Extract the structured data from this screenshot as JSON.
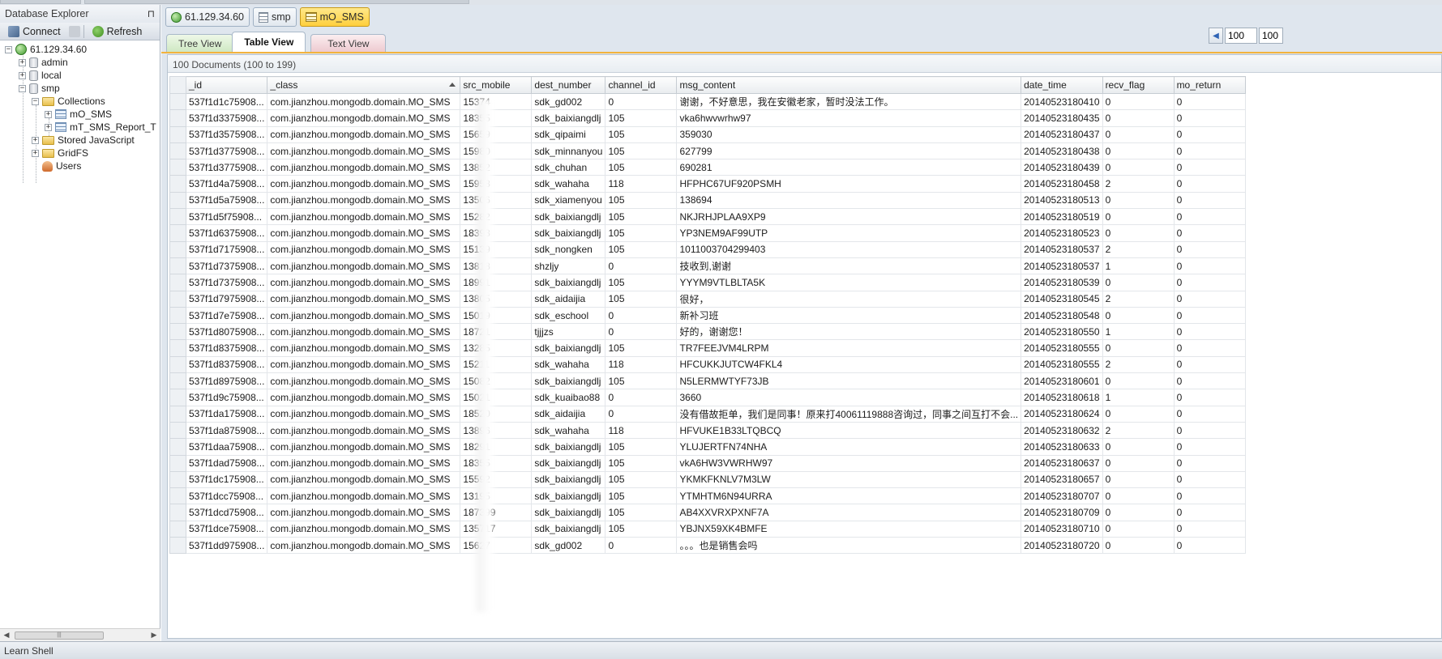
{
  "explorer": {
    "title": "Database Explorer",
    "pin_glyph": "⊓",
    "toolbar": {
      "connect": "Connect",
      "refresh": "Refresh"
    },
    "tree": {
      "server": "61.129.34.60",
      "dbs": [
        "admin",
        "local",
        "smp"
      ],
      "collections_folder": "Collections",
      "collections": [
        "mO_SMS",
        "mT_SMS_Report_T"
      ],
      "stored_js": "Stored JavaScript",
      "gridfs": "GridFS",
      "users": "Users"
    }
  },
  "doc_tabs": [
    "61.129.34.60",
    "smp",
    "mO_SMS"
  ],
  "view_tabs": {
    "tree": "Tree View",
    "table": "Table View",
    "text": "Text View"
  },
  "pager": {
    "skip": "100",
    "limit": "100"
  },
  "status": "100 Documents (100 to 199)",
  "columns": [
    "_id",
    "_class",
    "src_mobile",
    "dest_number",
    "channel_id",
    "msg_content",
    "date_time",
    "recv_flag",
    "mo_return"
  ],
  "rows": [
    [
      "537f1d1c75908...",
      "com.jianzhou.mongodb.domain.MO_SMS",
      "15374",
      "sdk_gd002",
      "0",
      "谢谢，不好意思，我在安徽老家，暂时没法工作。",
      "20140523180410",
      "0",
      "0"
    ],
    [
      "537f1d3375908...",
      "com.jianzhou.mongodb.domain.MO_SMS",
      "18355",
      "sdk_baixiangdlj",
      "105",
      "vka6hwvwrhw97",
      "20140523180435",
      "0",
      "0"
    ],
    [
      "537f1d3575908...",
      "com.jianzhou.mongodb.domain.MO_SMS",
      "15659",
      "sdk_qipaimi",
      "105",
      "359030",
      "20140523180437",
      "0",
      "0"
    ],
    [
      "537f1d3775908...",
      "com.jianzhou.mongodb.domain.MO_SMS",
      "15980",
      "sdk_minnanyou",
      "105",
      "627799",
      "20140523180438",
      "0",
      "0"
    ],
    [
      "537f1d3775908...",
      "com.jianzhou.mongodb.domain.MO_SMS",
      "13852",
      "sdk_chuhan",
      "105",
      "690281",
      "20140523180439",
      "0",
      "0"
    ],
    [
      "537f1d4a75908...",
      "com.jianzhou.mongodb.domain.MO_SMS",
      "15958",
      "sdk_wahaha",
      "118",
      "HFPHC67UF920PSMH",
      "20140523180458",
      "2",
      "0"
    ],
    [
      "537f1d5a75908...",
      "com.jianzhou.mongodb.domain.MO_SMS",
      "13506",
      "sdk_xiamenyou",
      "105",
      "138694",
      "20140523180513",
      "0",
      "0"
    ],
    [
      "537f1d5f75908...",
      "com.jianzhou.mongodb.domain.MO_SMS",
      "15282",
      "sdk_baixiangdlj",
      "105",
      "NKJRHJPLAA9XP9",
      "20140523180519",
      "0",
      "0"
    ],
    [
      "537f1d6375908...",
      "com.jianzhou.mongodb.domain.MO_SMS",
      "18393",
      "sdk_baixiangdlj",
      "105",
      "YP3NEM9AF99UTP",
      "20140523180523",
      "0",
      "0"
    ],
    [
      "537f1d7175908...",
      "com.jianzhou.mongodb.domain.MO_SMS",
      "15139",
      "sdk_nongken",
      "105",
      "1011003704299403",
      "20140523180537",
      "2",
      "0"
    ],
    [
      "537f1d7375908...",
      "com.jianzhou.mongodb.domain.MO_SMS",
      "13818",
      "shzljy",
      "0",
      "    技收到,谢谢",
      "20140523180537",
      "1",
      "0"
    ],
    [
      "537f1d7375908...",
      "com.jianzhou.mongodb.domain.MO_SMS",
      "18991",
      "sdk_baixiangdlj",
      "105",
      "YYYM9VTLBLTA5K",
      "20140523180539",
      "0",
      "0"
    ],
    [
      "537f1d7975908...",
      "com.jianzhou.mongodb.domain.MO_SMS",
      "13805",
      "sdk_aidaijia",
      "105",
      "很好，",
      "20140523180545",
      "2",
      "0"
    ],
    [
      "537f1d7e75908...",
      "com.jianzhou.mongodb.domain.MO_SMS",
      "15019",
      "sdk_eschool",
      "0",
      "新补习班",
      "20140523180548",
      "0",
      "0"
    ],
    [
      "537f1d8075908...",
      "com.jianzhou.mongodb.domain.MO_SMS",
      "18721",
      "tjjjzs",
      "0",
      "好的，谢谢您！",
      "20140523180550",
      "1",
      "0"
    ],
    [
      "537f1d8375908...",
      "com.jianzhou.mongodb.domain.MO_SMS",
      "13285",
      "sdk_baixiangdlj",
      "105",
      "TR7FEEJVM4LRPM",
      "20140523180555",
      "0",
      "0"
    ],
    [
      "537f1d8375908...",
      "com.jianzhou.mongodb.domain.MO_SMS",
      "15211",
      "sdk_wahaha",
      "118",
      "HFCUKKJUTCW4FKL4",
      "20140523180555",
      "2",
      "0"
    ],
    [
      "537f1d8975908...",
      "com.jianzhou.mongodb.domain.MO_SMS",
      "15082",
      "sdk_baixiangdlj",
      "105",
      "N5LERMWTYF73JB",
      "20140523180601",
      "0",
      "0"
    ],
    [
      "537f1d9c75908...",
      "com.jianzhou.mongodb.domain.MO_SMS",
      "15021",
      "sdk_kuaibao88",
      "0",
      "3660",
      "20140523180618",
      "1",
      "0"
    ],
    [
      "537f1da175908...",
      "com.jianzhou.mongodb.domain.MO_SMS",
      "18520",
      "sdk_aidaijia",
      "0",
      "没有借故拒单，我们是同事！原来打40061119888咨询过，同事之间互打不会...",
      "20140523180624",
      "0",
      "0"
    ],
    [
      "537f1da875908...",
      "com.jianzhou.mongodb.domain.MO_SMS",
      "13896",
      "sdk_wahaha",
      "118",
      "HFVUKE1B33LTQBCQ",
      "20140523180632",
      "2",
      "0"
    ],
    [
      "537f1daa75908...",
      "com.jianzhou.mongodb.domain.MO_SMS",
      "18291",
      "sdk_baixiangdlj",
      "105",
      "YLUJERTFN74NHA",
      "20140523180633",
      "0",
      "0"
    ],
    [
      "537f1dad75908...",
      "com.jianzhou.mongodb.domain.MO_SMS",
      "18355",
      "sdk_baixiangdlj",
      "105",
      "vkA6HW3VWRHW97",
      "20140523180637",
      "0",
      "0"
    ],
    [
      "537f1dc175908...",
      "com.jianzhou.mongodb.domain.MO_SMS",
      "15592",
      "sdk_baixiangdlj",
      "105",
      "YKMKFKNLV7M3LW",
      "20140523180657",
      "0",
      "0"
    ],
    [
      "537f1dcc75908...",
      "com.jianzhou.mongodb.domain.MO_SMS",
      "13195",
      "sdk_baixiangdlj",
      "105",
      "YTMHTM6N94URRA",
      "20140523180707",
      "0",
      "0"
    ],
    [
      "537f1dcd75908...",
      "com.jianzhou.mongodb.domain.MO_SMS",
      "187399",
      "sdk_baixiangdlj",
      "105",
      "AB4XXVRXPXNF7A",
      "20140523180709",
      "0",
      "0"
    ],
    [
      "537f1dce75908...",
      "com.jianzhou.mongodb.domain.MO_SMS",
      "135717",
      "sdk_baixiangdlj",
      "105",
      "YBJNX59XK4BMFE",
      "20140523180710",
      "0",
      "0"
    ],
    [
      "537f1dd975908...",
      "com.jianzhou.mongodb.domain.MO_SMS",
      "15627",
      "sdk_gd002",
      "0",
      "。。。也是销售会吗",
      "20140523180720",
      "0",
      "0"
    ]
  ],
  "bottom": {
    "label": "Learn Shell"
  },
  "colors": {
    "accent_tab": "#ffcf3d",
    "tab_underline": "#f2b33d",
    "server_green": "#3f9a2e"
  },
  "icons": [
    "pin-icon",
    "connect-icon",
    "disconnect-icon",
    "refresh-icon",
    "server-icon",
    "database-icon",
    "folder-icon",
    "collection-icon",
    "users-icon",
    "sort-ascending-icon",
    "chevron-left-icon"
  ]
}
